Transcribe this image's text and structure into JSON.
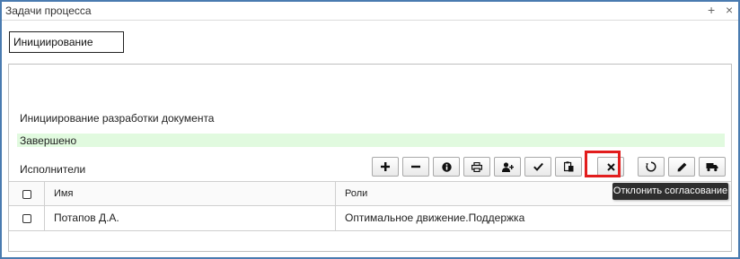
{
  "window": {
    "title": "Задачи процесса",
    "add_label": "+",
    "close_label": "×"
  },
  "process": {
    "name_value": "Инициирование"
  },
  "task": {
    "name": "Инициирование разработки документа",
    "status": "Завершено",
    "status_color": "#e1fadf",
    "performers_label": "Исполнители"
  },
  "toolbar": {
    "buttons": [
      {
        "icon": "plus-icon"
      },
      {
        "icon": "minus-icon"
      },
      {
        "icon": "info-icon"
      },
      {
        "icon": "print-icon"
      },
      {
        "icon": "add-user-icon"
      },
      {
        "icon": "check-icon"
      },
      {
        "icon": "paste-icon"
      },
      {
        "icon": "reject-x-icon"
      },
      {
        "icon": "recycle-icon"
      },
      {
        "icon": "pencil-icon"
      },
      {
        "icon": "delegate-icon"
      }
    ],
    "highlight_color": "#e21d1d",
    "tooltip": "Отклонить согласование"
  },
  "table": {
    "columns": [
      "Имя",
      "Роли"
    ],
    "rows": [
      {
        "name": "Потапов Д.А.",
        "role": "Оптимальное движение.Поддержка"
      }
    ]
  }
}
